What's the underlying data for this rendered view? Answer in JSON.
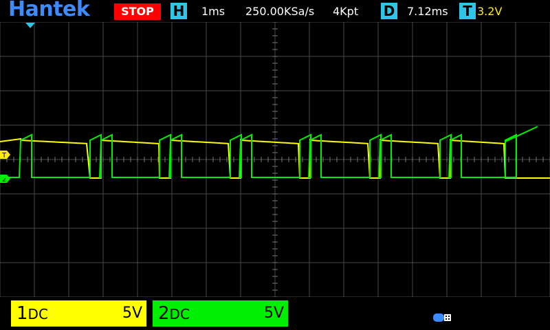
{
  "header": {
    "brand": "Hantek",
    "run_state": "STOP",
    "h_label": "H",
    "timebase": "1ms",
    "sample_rate": "250.00KSa/s",
    "memory_depth": "4Kpt",
    "d_label": "D",
    "delay": "7.12ms",
    "t_label": "T",
    "trigger_level": "3.2V"
  },
  "markers": {
    "trigger": "T",
    "ch2": "2"
  },
  "channels": [
    {
      "name": "1",
      "coupling": "DC",
      "scale": "5V",
      "color": "#ffff00"
    },
    {
      "name": "2",
      "coupling": "DC",
      "scale": "5V",
      "color": "#00ee00"
    }
  ],
  "colors": {
    "brand": "#3d8bff",
    "stop": "#ff0000",
    "tag": "#2ec6e6",
    "grid": "#4a4a4a",
    "trigger_marker": "#ffee00",
    "timebase_marker": "#2ec6e6"
  },
  "icons": {
    "usb": "usb-icon"
  }
}
